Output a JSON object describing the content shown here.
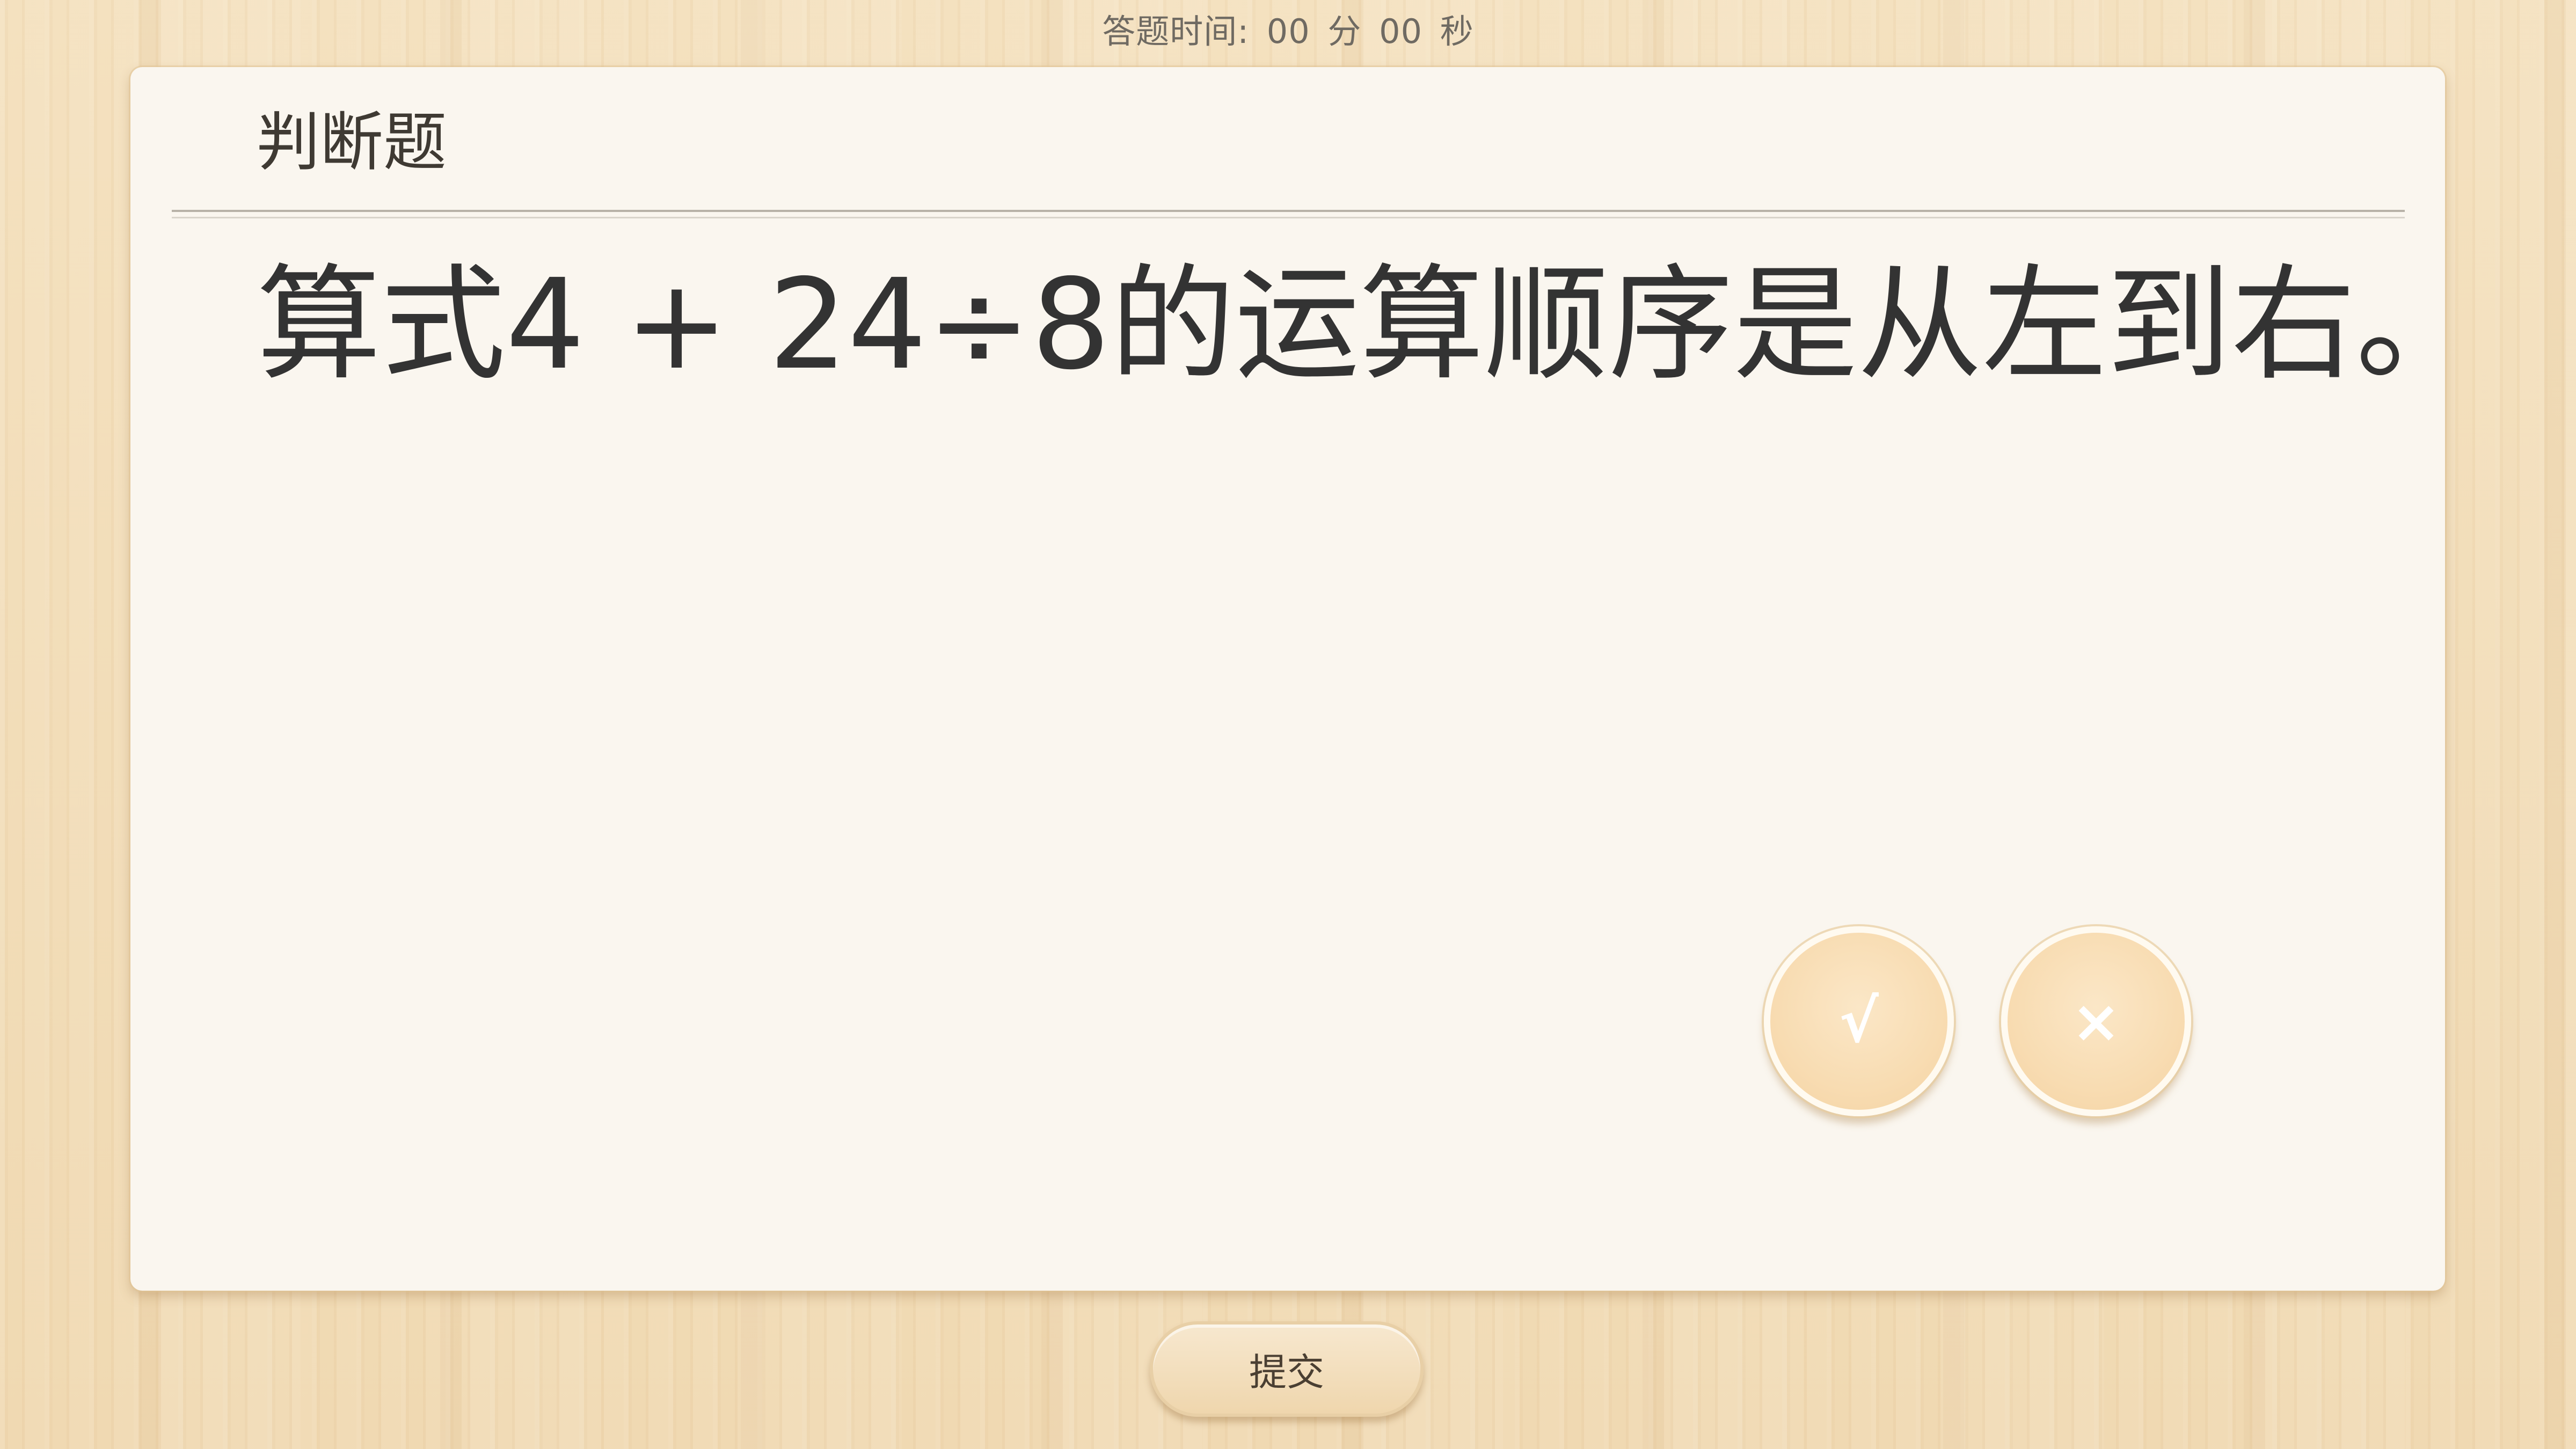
{
  "timer": {
    "label": "答题时间:",
    "minutes": "00",
    "minutes_unit": "分",
    "seconds": "00",
    "seconds_unit": "秒"
  },
  "question": {
    "type": "判断题",
    "text": "算式4 + 24÷8的运算顺序是从左到右。"
  },
  "answers": {
    "true_label": "√",
    "false_label": "×"
  },
  "submit_label": "提交",
  "colors": {
    "background": "#f2dcb7",
    "card": "#faf6ef",
    "answer_button": "#f8dcb2",
    "text": "#333333"
  }
}
